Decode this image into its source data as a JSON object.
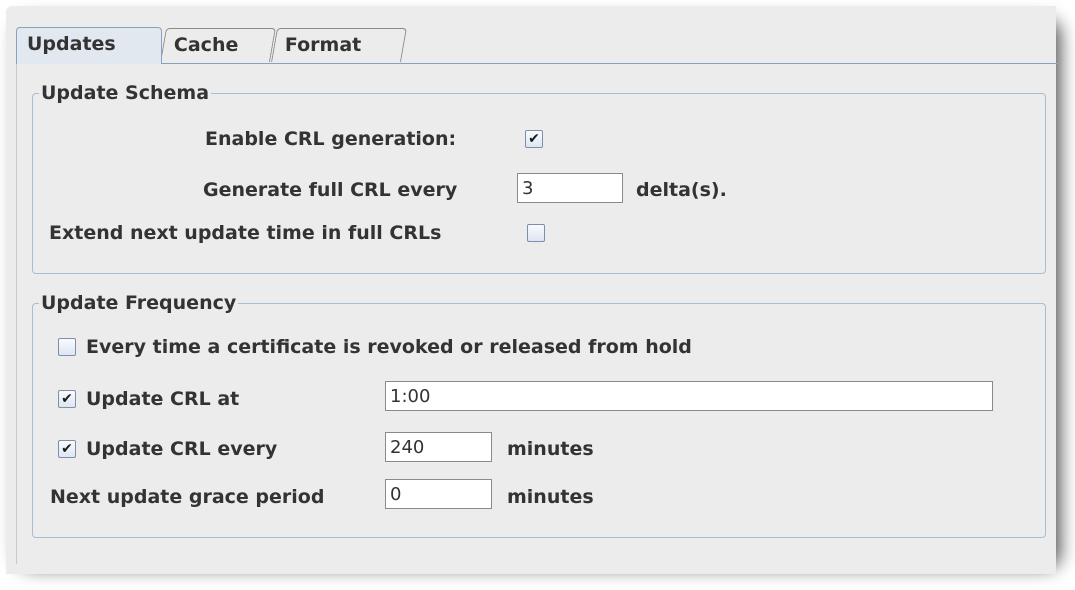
{
  "tabs": [
    "Updates",
    "Cache",
    "Format"
  ],
  "schema": {
    "legend": "Update Schema",
    "enable_crl_label": "Enable CRL generation:",
    "enable_crl_checked": true,
    "generate_full_label": "Generate full CRL every",
    "generate_full_value": "3",
    "generate_full_unit": "delta(s).",
    "extend_next_label": "Extend next update time in full CRLs",
    "extend_next_checked": false
  },
  "frequency": {
    "legend": "Update Frequency",
    "every_revoke_label": "Every time a certificate is revoked or released from hold",
    "every_revoke_checked": false,
    "update_at_label": "Update CRL at",
    "update_at_checked": true,
    "update_at_value": "1:00",
    "update_every_label": "Update CRL every",
    "update_every_checked": true,
    "update_every_value": "240",
    "update_every_unit": "minutes",
    "grace_label": "Next update grace period",
    "grace_value": "0",
    "grace_unit": "minutes"
  },
  "icons": {
    "checked": "✔",
    "unchecked": ""
  }
}
